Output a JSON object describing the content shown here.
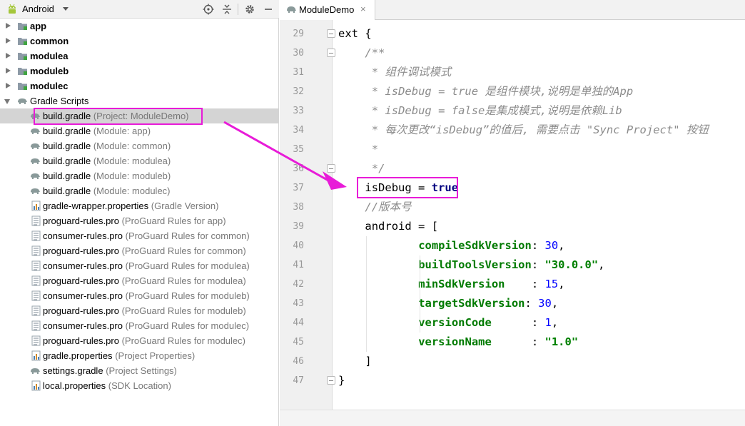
{
  "left_panel": {
    "view_selector": "Android",
    "toolbar_icons": [
      "locate-icon",
      "collapse-icon",
      "gear-icon",
      "hide-panel-icon"
    ],
    "tree": [
      {
        "type": "module",
        "label": "app",
        "expanded": false
      },
      {
        "type": "module",
        "label": "common",
        "expanded": false
      },
      {
        "type": "module",
        "label": "modulea",
        "expanded": false
      },
      {
        "type": "module",
        "label": "moduleb",
        "expanded": false
      },
      {
        "type": "module",
        "label": "modulec",
        "expanded": false
      },
      {
        "type": "group",
        "label": "Gradle Scripts",
        "expanded": true
      },
      {
        "type": "gradle",
        "label": "build.gradle",
        "hint": "(Project: ModuleDemo)",
        "selected": true
      },
      {
        "type": "gradle",
        "label": "build.gradle",
        "hint": "(Module: app)"
      },
      {
        "type": "gradle",
        "label": "build.gradle",
        "hint": "(Module: common)"
      },
      {
        "type": "gradle",
        "label": "build.gradle",
        "hint": "(Module: modulea)"
      },
      {
        "type": "gradle",
        "label": "build.gradle",
        "hint": "(Module: moduleb)"
      },
      {
        "type": "gradle",
        "label": "build.gradle",
        "hint": "(Module: modulec)"
      },
      {
        "type": "props",
        "label": "gradle-wrapper.properties",
        "hint": "(Gradle Version)"
      },
      {
        "type": "pro",
        "label": "proguard-rules.pro",
        "hint": "(ProGuard Rules for app)"
      },
      {
        "type": "pro",
        "label": "consumer-rules.pro",
        "hint": "(ProGuard Rules for common)"
      },
      {
        "type": "pro",
        "label": "proguard-rules.pro",
        "hint": "(ProGuard Rules for common)"
      },
      {
        "type": "pro",
        "label": "consumer-rules.pro",
        "hint": "(ProGuard Rules for modulea)"
      },
      {
        "type": "pro",
        "label": "proguard-rules.pro",
        "hint": "(ProGuard Rules for modulea)"
      },
      {
        "type": "pro",
        "label": "consumer-rules.pro",
        "hint": "(ProGuard Rules for moduleb)"
      },
      {
        "type": "pro",
        "label": "proguard-rules.pro",
        "hint": "(ProGuard Rules for moduleb)"
      },
      {
        "type": "pro",
        "label": "consumer-rules.pro",
        "hint": "(ProGuard Rules for modulec)"
      },
      {
        "type": "pro",
        "label": "proguard-rules.pro",
        "hint": "(ProGuard Rules for modulec)"
      },
      {
        "type": "props",
        "label": "gradle.properties",
        "hint": "(Project Properties)"
      },
      {
        "type": "gradle",
        "label": "settings.gradle",
        "hint": "(Project Settings)"
      },
      {
        "type": "props",
        "label": "local.properties",
        "hint": "(SDK Location)"
      }
    ]
  },
  "editor": {
    "tab_label": "ModuleDemo",
    "tab_close": "×",
    "lines": [
      {
        "n": "29",
        "indent": 0,
        "parts": [
          [
            "kw-plain",
            "ext {"
          ]
        ]
      },
      {
        "n": "30",
        "indent": 4,
        "parts": [
          [
            "cm",
            "/**"
          ]
        ]
      },
      {
        "n": "31",
        "indent": 5,
        "parts": [
          [
            "cm",
            "* 组件调试模式"
          ]
        ]
      },
      {
        "n": "32",
        "indent": 5,
        "parts": [
          [
            "cm",
            "* isDebug = true 是组件模块,说明是单独的App"
          ]
        ]
      },
      {
        "n": "33",
        "indent": 5,
        "parts": [
          [
            "cm",
            "* isDebug = false是集成模式,说明是依赖Lib"
          ]
        ]
      },
      {
        "n": "34",
        "indent": 5,
        "parts": [
          [
            "cm",
            "* 每次更改“isDebug”的值后, 需要点击 \"Sync Project\" 按钮"
          ]
        ]
      },
      {
        "n": "35",
        "indent": 5,
        "parts": [
          [
            "cm",
            "*"
          ]
        ]
      },
      {
        "n": "36",
        "indent": 5,
        "parts": [
          [
            "cm",
            "*/"
          ]
        ]
      },
      {
        "n": "37",
        "indent": 4,
        "parts": [
          [
            "plain",
            "isDebug = "
          ],
          [
            "kw",
            "true"
          ]
        ]
      },
      {
        "n": "38",
        "indent": 4,
        "parts": [
          [
            "cm",
            "//版本号"
          ]
        ]
      },
      {
        "n": "39",
        "indent": 4,
        "parts": [
          [
            "plain",
            "android = ["
          ]
        ]
      },
      {
        "n": "40",
        "indent": 12,
        "parts": [
          [
            "prop",
            "compileSdkVersion"
          ],
          [
            "plain",
            ": "
          ],
          [
            "num",
            "30"
          ],
          [
            "plain",
            ","
          ]
        ]
      },
      {
        "n": "41",
        "indent": 12,
        "parts": [
          [
            "prop",
            "buildToolsVersion"
          ],
          [
            "plain",
            ": "
          ],
          [
            "str",
            "\"30.0.0\""
          ],
          [
            "plain",
            ","
          ]
        ]
      },
      {
        "n": "42",
        "indent": 12,
        "parts": [
          [
            "prop",
            "minSdkVersion"
          ],
          [
            "plain",
            "    : "
          ],
          [
            "num",
            "15"
          ],
          [
            "plain",
            ","
          ]
        ]
      },
      {
        "n": "43",
        "indent": 12,
        "parts": [
          [
            "prop",
            "targetSdkVersion"
          ],
          [
            "plain",
            ": "
          ],
          [
            "num",
            "30"
          ],
          [
            "plain",
            ","
          ]
        ]
      },
      {
        "n": "44",
        "indent": 12,
        "parts": [
          [
            "prop",
            "versionCode"
          ],
          [
            "plain",
            "      : "
          ],
          [
            "num",
            "1"
          ],
          [
            "plain",
            ","
          ]
        ]
      },
      {
        "n": "45",
        "indent": 12,
        "parts": [
          [
            "prop",
            "versionName"
          ],
          [
            "plain",
            "      : "
          ],
          [
            "str",
            "\"1.0\""
          ]
        ]
      },
      {
        "n": "46",
        "indent": 4,
        "parts": [
          [
            "plain",
            "]"
          ]
        ]
      },
      {
        "n": "47",
        "indent": 0,
        "parts": [
          [
            "plain",
            "}"
          ]
        ]
      }
    ]
  },
  "colors": {
    "annotation": "#e81bd8",
    "selection": "#d4d4d4",
    "comment": "#8c8c8c",
    "keyword": "#000080",
    "property": "#007a00",
    "number": "#0000ff",
    "string": "#008000"
  }
}
